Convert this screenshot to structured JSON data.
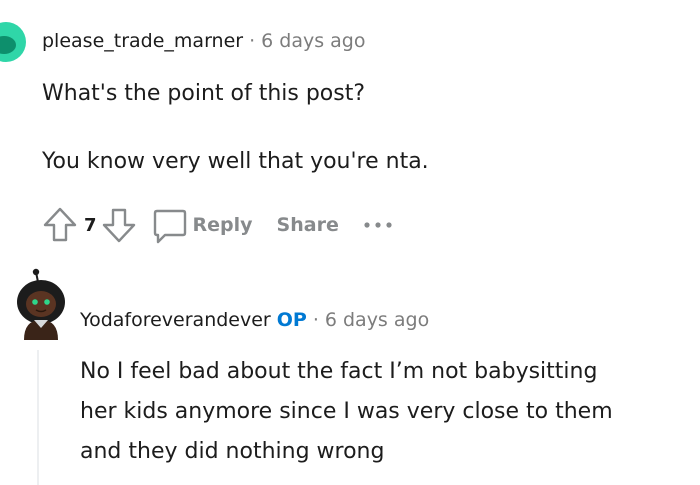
{
  "top_comment": {
    "username": "please_trade_marner",
    "separator": "·",
    "time": "6 days ago",
    "paragraphs": [
      "What's the point of this post?",
      "You know very well that you're nta."
    ],
    "votes": "7",
    "actions": {
      "reply_label": "Reply",
      "share_label": "Share",
      "more_label": "···"
    }
  },
  "reply_comment": {
    "username": "Yodaforeverandever",
    "op_badge": "OP",
    "separator": "·",
    "time": "6 days ago",
    "lines": [
      "No I feel bad about the fact I’m not babysitting",
      "her kids anymore since I was very close to them",
      "and they did nothing wrong"
    ]
  },
  "icons": {
    "top_avatar": "avatar-icon",
    "upvote": "upvote-arrow-icon",
    "downvote": "downvote-arrow-icon",
    "reply": "comment-bubble-icon",
    "more": "more-dots-icon",
    "reply_avatar": "snoo-avatar-icon"
  },
  "colors": {
    "top_avatar_bg": "#2fd6a8",
    "op_badge": "#0079d3",
    "meta_gray": "#7c7c7c",
    "action_gray": "#878a8c",
    "thread_line": "#edeff1"
  }
}
